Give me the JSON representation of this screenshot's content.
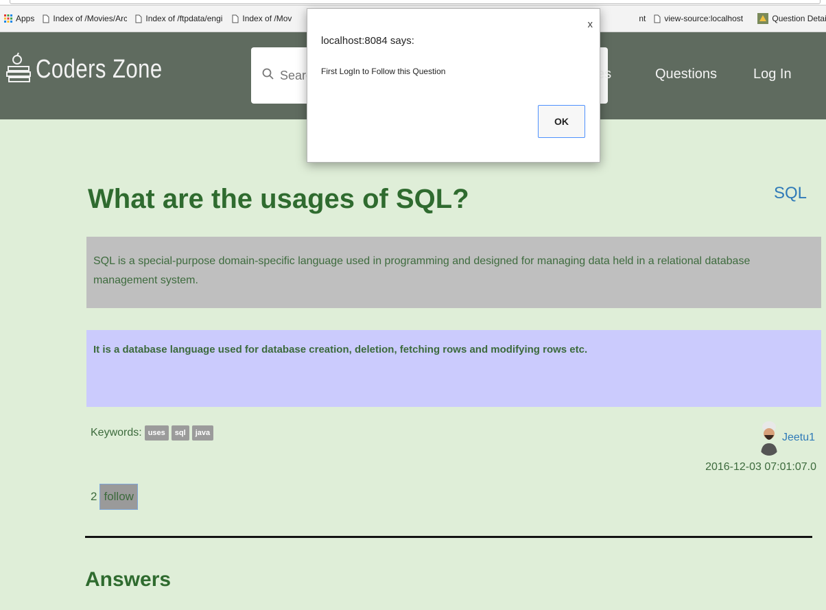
{
  "bookmarks": [
    {
      "label": "Apps",
      "icon": "apps-grid-icon"
    },
    {
      "label": "Index of /Movies/Arch",
      "icon": "page-icon"
    },
    {
      "label": "Index of /ftpdata/engi",
      "icon": "page-icon"
    },
    {
      "label": "Index of /Mov",
      "icon": "page-icon"
    },
    {
      "label": "nt",
      "icon": ""
    },
    {
      "label": "view-source:localhost",
      "icon": "page-icon"
    },
    {
      "label": "Question Details",
      "icon": "favicon-icon"
    }
  ],
  "navbar": {
    "brand": "Coders Zone",
    "search_placeholder": "Search",
    "links": [
      "es",
      "Questions",
      "Log In"
    ]
  },
  "dialog": {
    "title": "localhost:8084 says:",
    "message": "First LogIn to Follow this Question",
    "ok_label": "OK",
    "close_label": "x"
  },
  "question": {
    "title": "What are the usages of SQL?",
    "category": "SQL",
    "description": "SQL is a special-purpose domain-specific language used in programming and designed for managing data held in a relational database management system.",
    "answer_preview": "It is a database language used for database creation, deletion, fetching rows and modifying rows etc.",
    "keywords_label": "Keywords:",
    "keywords": [
      "uses",
      "sql",
      "java"
    ],
    "author": "Jeetu1",
    "date": "2016-12-03 07:01:07.0",
    "follow_count": "2",
    "follow_label": "follow"
  },
  "answers": {
    "heading": "Answers"
  },
  "colors": {
    "page_bg": "#dfeed8",
    "navbar_bg": "#5f6b5f",
    "title_green": "#2f6b2f",
    "link_blue": "#2f7ab8",
    "desc_bg": "#bfbfbf",
    "answer_bg": "#cbcbfd"
  }
}
